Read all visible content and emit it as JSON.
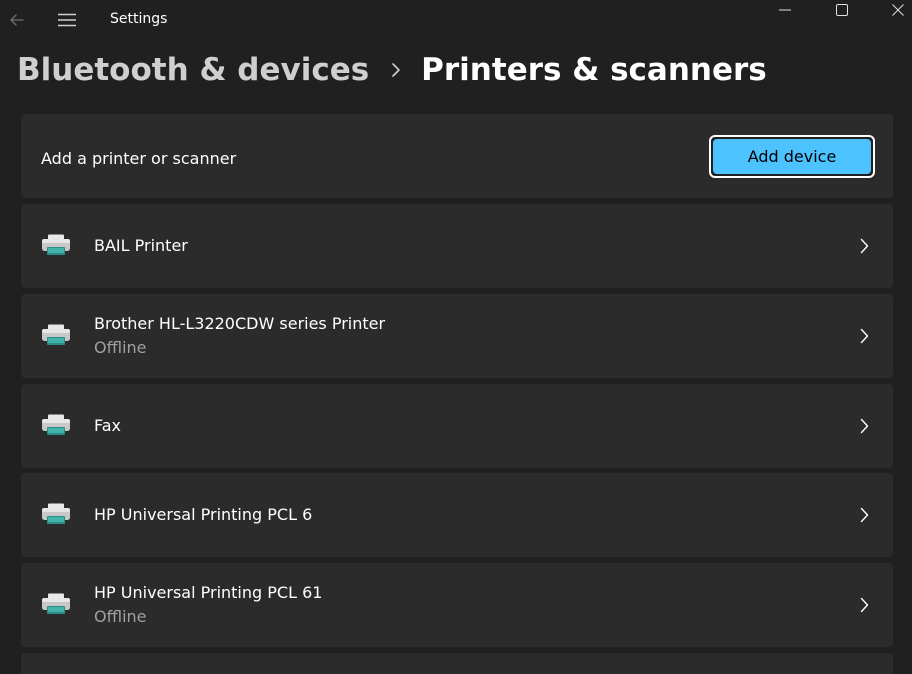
{
  "window": {
    "title": "Settings"
  },
  "breadcrumb": {
    "parent": "Bluetooth & devices",
    "current": "Printers & scanners"
  },
  "add_printer": {
    "label": "Add a printer or scanner",
    "button_label": "Add device",
    "button_color": "#4cc2ff"
  },
  "printers": [
    {
      "name": "BAIL Printer",
      "status": ""
    },
    {
      "name": "Brother HL-L3220CDW series Printer",
      "status": "Offline"
    },
    {
      "name": "Fax",
      "status": ""
    },
    {
      "name": "HP Universal Printing PCL 6",
      "status": ""
    },
    {
      "name": "HP Universal Printing PCL 61",
      "status": "Offline"
    }
  ],
  "icons": {
    "back": "back-arrow-icon",
    "menu": "hamburger-menu-icon",
    "printer": "printer-icon",
    "chevron": "chevron-right-icon"
  }
}
